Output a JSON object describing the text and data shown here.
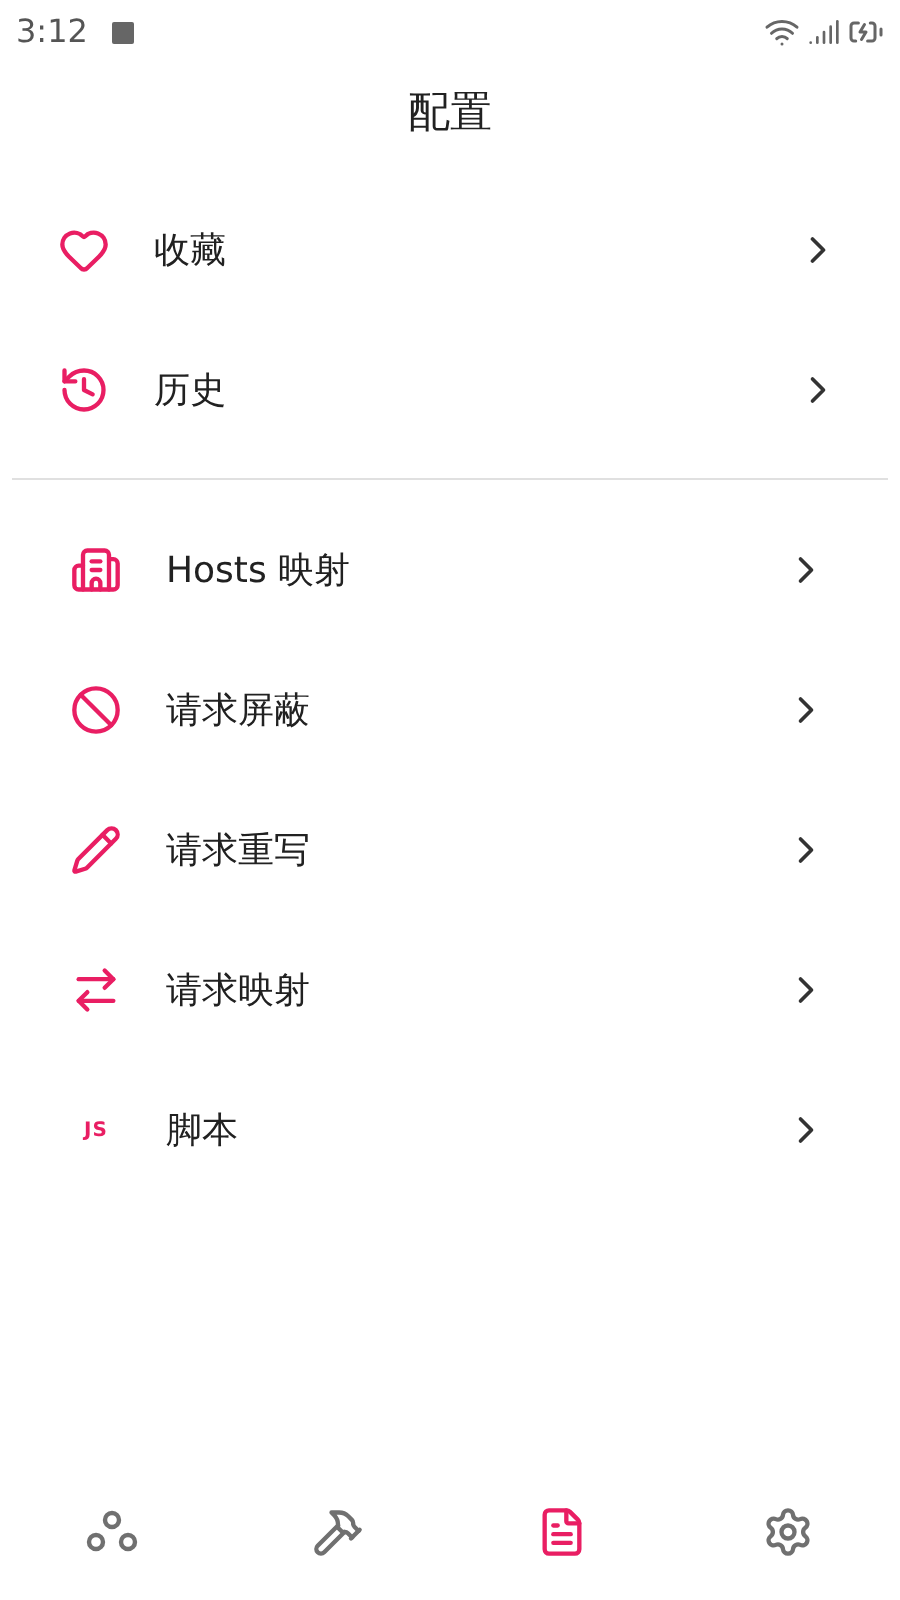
{
  "status_bar": {
    "time": "3:12"
  },
  "title": "配置",
  "groups": [
    {
      "items": [
        {
          "kind": "heart",
          "label": "收藏"
        },
        {
          "kind": "history",
          "label": "历史"
        }
      ]
    },
    {
      "items": [
        {
          "kind": "building",
          "label": "Hosts 映射"
        },
        {
          "kind": "block",
          "label": "请求屏蔽"
        },
        {
          "kind": "pencil",
          "label": "请求重写"
        },
        {
          "kind": "swap",
          "label": "请求映射"
        },
        {
          "kind": "js",
          "label": "脚本",
          "icon_text": "JS"
        }
      ]
    }
  ],
  "nav": [
    {
      "kind": "nodes",
      "selected": false
    },
    {
      "kind": "hammer",
      "selected": false
    },
    {
      "kind": "doc",
      "selected": true
    },
    {
      "kind": "gear",
      "selected": false
    }
  ]
}
